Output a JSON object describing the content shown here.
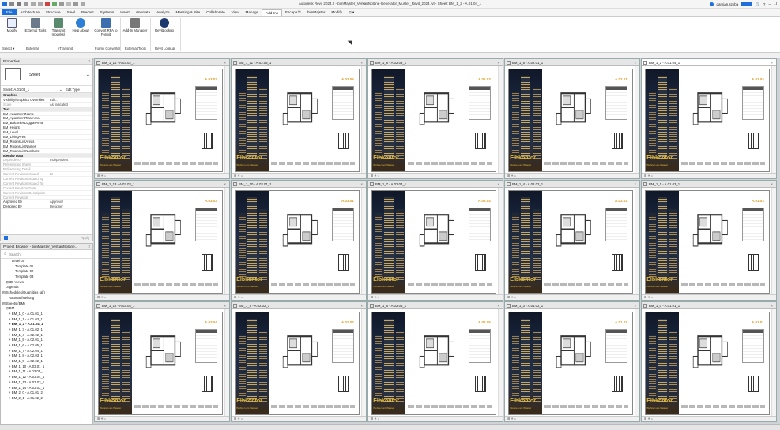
{
  "app": {
    "title": "Autodesk Revit 2024.2 - bimMajster_Verkaufspläne-Generator_Muster_Revit_2024.rvt - Sheet: BM_1_2 - A.01.04_1",
    "user": "damian.szyba",
    "colors": {
      "file_tab": "#1e6fd9",
      "accent_orange": "#e29a1a",
      "brand_gold": "#e2b93b"
    }
  },
  "menu": {
    "tabs": [
      "File",
      "Architecture",
      "Structure",
      "Steel",
      "Precast",
      "Systems",
      "Insert",
      "Annotate",
      "Analyze",
      "Massing & Site",
      "Collaborate",
      "View",
      "Manage",
      "Add-Ins",
      "Escape™",
      "bimMajster",
      "Modify",
      "⊡ ▾"
    ],
    "active": "Add-Ins"
  },
  "ribbon": {
    "buttons": [
      {
        "label": "Modify",
        "icon": "cursor-icon"
      },
      {
        "label": "External Tools",
        "icon": "tools-icon"
      },
      {
        "label": "Transmit model(s)",
        "icon": "transmit-icon"
      },
      {
        "label": "Help About",
        "icon": "help-icon"
      },
      {
        "label": "Convert RFA to Formit",
        "icon": "convert-icon"
      },
      {
        "label": "Add-In Manager",
        "icon": "addin-manager-icon"
      },
      {
        "label": "RevitLookup",
        "icon": "lookup-icon"
      }
    ],
    "panels": [
      "Select ▾",
      "External",
      "eTransmit",
      "Formit Converter",
      "External Tools",
      "Revit Lookup"
    ]
  },
  "properties": {
    "header": "Properties",
    "type_name": "Sheet",
    "selector": "Sheet: A.01.04_1",
    "edit_type": "Edit Type",
    "rows": [
      {
        "k": "Graphics",
        "v": "",
        "kind": "group"
      },
      {
        "k": "Visibility/Graphics Overrides",
        "v": "Edit...",
        "kind": "row"
      },
      {
        "k": "Scale",
        "v": "As indicated",
        "kind": "grey"
      },
      {
        "k": "Text",
        "v": "",
        "kind": "group"
      },
      {
        "k": "BM_ApartmentName",
        "v": "",
        "kind": "row"
      },
      {
        "k": "BM_ApartmentTotalArea",
        "v": "",
        "kind": "row"
      },
      {
        "k": "BM_BalconiesLoggiasArea",
        "v": "",
        "kind": "row"
      },
      {
        "k": "BM_Height",
        "v": "",
        "kind": "row"
      },
      {
        "k": "BM_Level",
        "v": "",
        "kind": "row"
      },
      {
        "k": "BM_LivingArea",
        "v": "",
        "kind": "row"
      },
      {
        "k": "BM_RoomsListAreas",
        "v": "",
        "kind": "row"
      },
      {
        "k": "BM_RoomsListNames",
        "v": "",
        "kind": "row"
      },
      {
        "k": "BM_RoomsListNumbers",
        "v": "",
        "kind": "row"
      },
      {
        "k": "Identity Data",
        "v": "",
        "kind": "group"
      },
      {
        "k": "Dependency",
        "v": "Independent",
        "kind": "grey"
      },
      {
        "k": "Referencing Sheet",
        "v": "",
        "kind": "grey"
      },
      {
        "k": "Referencing Detail",
        "v": "",
        "kind": "grey"
      },
      {
        "k": "Current Revision Issued",
        "v": "☐",
        "kind": "grey"
      },
      {
        "k": "Current Revision Issued By",
        "v": "",
        "kind": "grey"
      },
      {
        "k": "Current Revision Issued To",
        "v": "",
        "kind": "grey"
      },
      {
        "k": "Current Revision Date",
        "v": "",
        "kind": "grey"
      },
      {
        "k": "Current Revision Description",
        "v": "",
        "kind": "grey"
      },
      {
        "k": "Current Revision",
        "v": "",
        "kind": "grey"
      },
      {
        "k": "Approved By",
        "v": "Approver",
        "kind": "row"
      },
      {
        "k": "Designed By",
        "v": "Designer",
        "kind": "row"
      }
    ],
    "apply": "Apply"
  },
  "browser": {
    "header": "Project Browser - bimMajster_Verkaufsplänе...",
    "search_placeholder": "Search",
    "items": [
      {
        "label": "Level 00",
        "indent": 14,
        "bold": false
      },
      {
        "label": "Template 01",
        "indent": 18,
        "bold": false
      },
      {
        "label": "Template 02",
        "indent": 18,
        "bold": false
      },
      {
        "label": "Template 03",
        "indent": 18,
        "bold": false
      },
      {
        "label": "⊞ 3D Views",
        "indent": 6,
        "bold": false
      },
      {
        "label": "Legends",
        "indent": 6,
        "bold": false
      },
      {
        "label": "⊟ Schedules/Quantities (all)",
        "indent": 2,
        "bold": false
      },
      {
        "label": "Raumaufstellung",
        "indent": 10,
        "bold": false
      },
      {
        "label": "⊟ Sheets (BM)",
        "indent": 2,
        "bold": false
      },
      {
        "label": "⊟ BM",
        "indent": 6,
        "bold": false
      },
      {
        "label": "+ BM_1_0 - A.01.01_1",
        "indent": 10,
        "bold": false
      },
      {
        "label": "+ BM_1_1 - A.01.03_1",
        "indent": 10,
        "bold": false
      },
      {
        "label": "+ BM_1_2 - A.01.04_1",
        "indent": 10,
        "bold": true
      },
      {
        "label": "+ BM_1_3 - A.01.02_1",
        "indent": 10,
        "bold": false
      },
      {
        "label": "+ BM_1_4 - A.02.02_1",
        "indent": 10,
        "bold": false
      },
      {
        "label": "+ BM_1_5 - A.02.01_1",
        "indent": 10,
        "bold": false
      },
      {
        "label": "+ BM_1_6 - A.02.05_1",
        "indent": 10,
        "bold": false
      },
      {
        "label": "+ BM_1_7 - A.02.04_1",
        "indent": 10,
        "bold": false
      },
      {
        "label": "+ BM_1_8 - A.02.03_1",
        "indent": 10,
        "bold": false
      },
      {
        "label": "+ BM_1_9 - A.02.02_1",
        "indent": 10,
        "bold": false
      },
      {
        "label": "+ BM_1_10 - A.03.01_1",
        "indent": 10,
        "bold": false
      },
      {
        "label": "+ BM_1_11 - A.03.05_1",
        "indent": 10,
        "bold": false
      },
      {
        "label": "+ BM_1_12 - A.03.04_1",
        "indent": 10,
        "bold": false
      },
      {
        "label": "+ BM_1_13 - A.03.03_1",
        "indent": 10,
        "bold": false
      },
      {
        "label": "+ BM_1_14 - A.03.02_1",
        "indent": 10,
        "bold": false
      },
      {
        "label": "+ BM_2_0 - A.01.01_2",
        "indent": 10,
        "bold": false
      },
      {
        "label": "+ BM_2_1 - A.01.02_2",
        "indent": 10,
        "bold": false
      }
    ]
  },
  "views": [
    {
      "tab": "BM_1_14 - A.03.02_1",
      "code": "A.03.02",
      "active": false
    },
    {
      "tab": "BM_1_11 - A.03.05_1",
      "code": "A.03.05",
      "active": false
    },
    {
      "tab": "BM_1_8 - A.02.03_1",
      "code": "A.02.03",
      "active": false
    },
    {
      "tab": "BM_1_5 - A.02.01_1",
      "code": "A.02.01",
      "active": false
    },
    {
      "tab": "BM_1_2 - A.01.04_1",
      "code": "A.01.04",
      "active": true
    },
    {
      "tab": "BM_1_13 - A.03.03_1",
      "code": "A.03.03",
      "active": false
    },
    {
      "tab": "BM_1_10 - A.03.01_1",
      "code": "A.03.01",
      "active": false
    },
    {
      "tab": "BM_1_7 - A.02.04_1",
      "code": "A.02.04",
      "active": false
    },
    {
      "tab": "BM_1_4 - A.02.02_1",
      "code": "A.02.02",
      "active": false
    },
    {
      "tab": "BM_1_1 - A.01.03_1",
      "code": "A.01.03",
      "active": false
    },
    {
      "tab": "BM_1_12 - A.03.04_1",
      "code": "A.03.04",
      "active": false
    },
    {
      "tab": "BM_1_9 - A.02.02_1",
      "code": "A.02.02",
      "active": false
    },
    {
      "tab": "BM_1_6 - A.02.05_1",
      "code": "A.02.05",
      "active": false
    },
    {
      "tab": "BM_1_3 - A.01.02_1",
      "code": "A.01.02",
      "active": false
    },
    {
      "tab": "BM_1_0 - A.01.01_1",
      "code": "A.01.01",
      "active": false
    }
  ],
  "brand": {
    "name": "Elbkontor",
    "sub": "Wohnen am Wasser"
  }
}
